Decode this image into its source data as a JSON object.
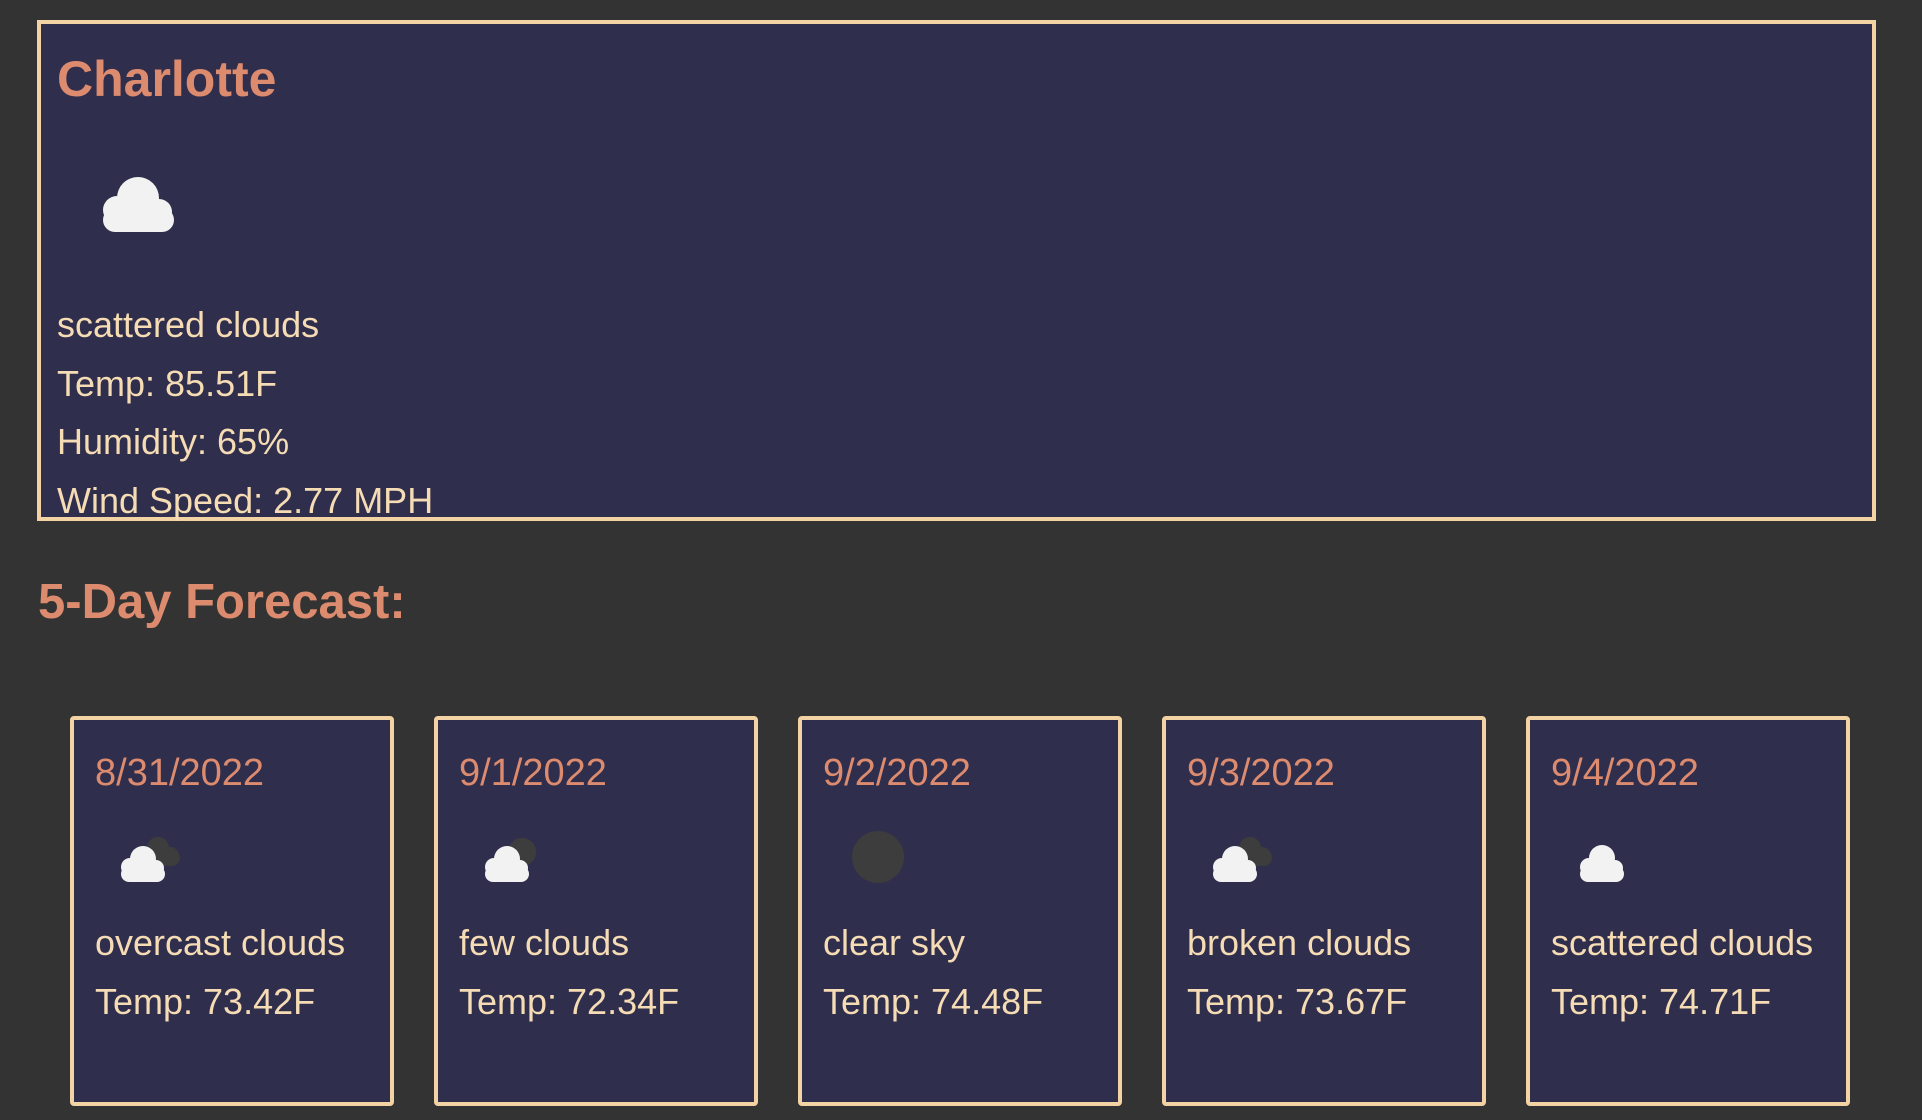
{
  "current": {
    "city": "Charlotte",
    "icon": "scattered-clouds-icon",
    "description": "scattered clouds",
    "temp": "Temp: 85.51F",
    "humidity": "Humidity: 65%",
    "wind": "Wind Speed: 2.77 MPH"
  },
  "forecast_title": "5-Day Forecast:",
  "forecast": [
    {
      "date": "8/31/2022",
      "icon": "overcast-clouds-icon",
      "description": "overcast clouds",
      "temp": "Temp: 73.42F"
    },
    {
      "date": "9/1/2022",
      "icon": "few-clouds-icon",
      "description": "few clouds",
      "temp": "Temp: 72.34F"
    },
    {
      "date": "9/2/2022",
      "icon": "clear-sky-icon",
      "description": "clear sky",
      "temp": "Temp: 74.48F"
    },
    {
      "date": "9/3/2022",
      "icon": "broken-clouds-icon",
      "description": "broken clouds",
      "temp": "Temp: 73.67F"
    },
    {
      "date": "9/4/2022",
      "icon": "scattered-clouds-icon",
      "description": "scattered clouds",
      "temp": "Temp: 74.71F"
    }
  ],
  "colors": {
    "page_bg": "#333333",
    "card_bg": "#302e4d",
    "border": "#f3d3a3",
    "accent": "#dd8b6e",
    "text": "#f5dcb4"
  }
}
